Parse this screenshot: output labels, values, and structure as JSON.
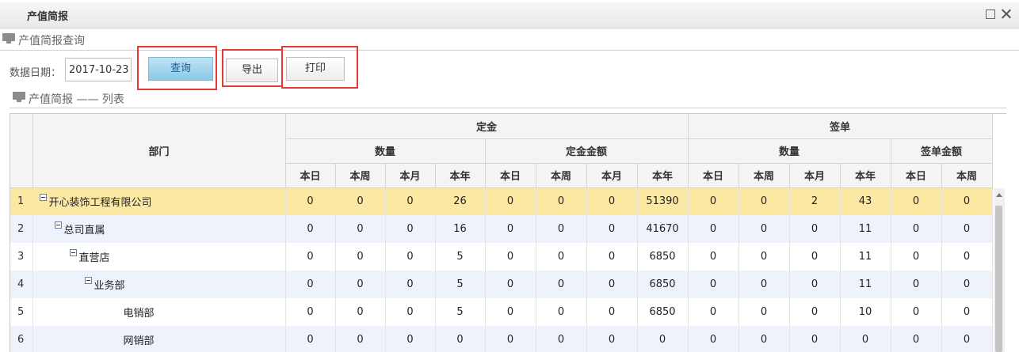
{
  "window": {
    "title": "产值简报"
  },
  "query_section": {
    "title": "产值简报查询"
  },
  "query": {
    "date_label": "数据日期：",
    "date_value": "2017-10-23",
    "query_label": "查询",
    "export_label": "导出",
    "print_label": "打印"
  },
  "list_section": {
    "title": "产值简报 —— 列表"
  },
  "table": {
    "dept_header": "部门",
    "groups": [
      {
        "label": "定金",
        "subgroups": [
          "数量",
          "定金金额"
        ]
      },
      {
        "label": "签单",
        "subgroups": [
          "数量",
          "签单金额"
        ]
      }
    ],
    "periods": [
      "本日",
      "本周",
      "本月",
      "本年"
    ],
    "rows": [
      {
        "num": "1",
        "dept": "开心装饰工程有限公司",
        "level": 0,
        "collapsible": true,
        "selected": true,
        "values": [
          "0",
          "0",
          "0",
          "26",
          "0",
          "0",
          "0",
          "51390",
          "0",
          "0",
          "2",
          "43",
          "0",
          "0"
        ]
      },
      {
        "num": "2",
        "dept": "总司直属",
        "level": 1,
        "collapsible": true,
        "selected": false,
        "values": [
          "0",
          "0",
          "0",
          "16",
          "0",
          "0",
          "0",
          "41670",
          "0",
          "0",
          "0",
          "11",
          "0",
          "0"
        ]
      },
      {
        "num": "3",
        "dept": "直营店",
        "level": 2,
        "collapsible": true,
        "selected": false,
        "values": [
          "0",
          "0",
          "0",
          "5",
          "0",
          "0",
          "0",
          "6850",
          "0",
          "0",
          "0",
          "11",
          "0",
          "0"
        ]
      },
      {
        "num": "4",
        "dept": "业务部",
        "level": 3,
        "collapsible": true,
        "selected": false,
        "values": [
          "0",
          "0",
          "0",
          "5",
          "0",
          "0",
          "0",
          "6850",
          "0",
          "0",
          "0",
          "11",
          "0",
          "0"
        ]
      },
      {
        "num": "5",
        "dept": "电销部",
        "level": 4,
        "collapsible": false,
        "selected": false,
        "values": [
          "0",
          "0",
          "0",
          "5",
          "0",
          "0",
          "0",
          "6850",
          "0",
          "0",
          "0",
          "10",
          "0",
          "0"
        ]
      },
      {
        "num": "6",
        "dept": "网销部",
        "level": 4,
        "collapsible": false,
        "selected": false,
        "values": [
          "0",
          "0",
          "0",
          "0",
          "0",
          "0",
          "0",
          "0",
          "0",
          "0",
          "0",
          "0",
          "0",
          "0"
        ]
      }
    ]
  }
}
